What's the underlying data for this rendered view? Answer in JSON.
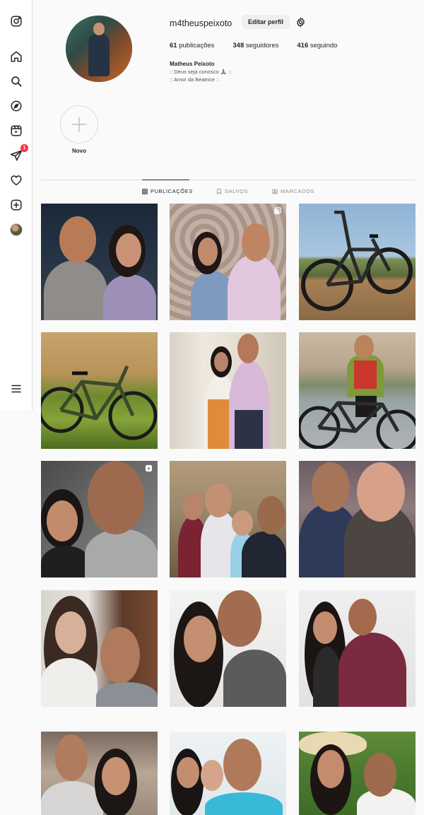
{
  "profile": {
    "username": "m4theuspeixoto",
    "edit_label": "Editar perfil",
    "stats": {
      "posts_count": "61",
      "posts_label": "publicações",
      "followers_count": "348",
      "followers_label": "seguidores",
      "following_count": "416",
      "following_label": "seguindo"
    },
    "name": "Matheus Peixoto",
    "bio_lines": [
      ":: Deus seja conosco 🙏🏽 ::",
      ":: Amor da Beatrice ::"
    ]
  },
  "highlight": {
    "label": "Novo"
  },
  "tabs": [
    {
      "label": "PUBLICAÇÕES",
      "icon": "grid-icon",
      "active": true
    },
    {
      "label": "SALVOS",
      "icon": "bookmark-icon",
      "active": false
    },
    {
      "label": "MARCADOS",
      "icon": "tagged-icon",
      "active": false
    }
  ],
  "sidebar": [
    "instagram-logo-icon",
    "home-icon",
    "search-icon",
    "explore-icon",
    "reels-icon",
    "messages-icon",
    "notifications-icon",
    "create-icon",
    "profile-avatar",
    "menu-icon"
  ],
  "messages_badge": "1",
  "colors": {
    "badge": "#ff3040",
    "border": "#dbdbdb",
    "text": "#262626",
    "muted": "#8e8e8e"
  }
}
